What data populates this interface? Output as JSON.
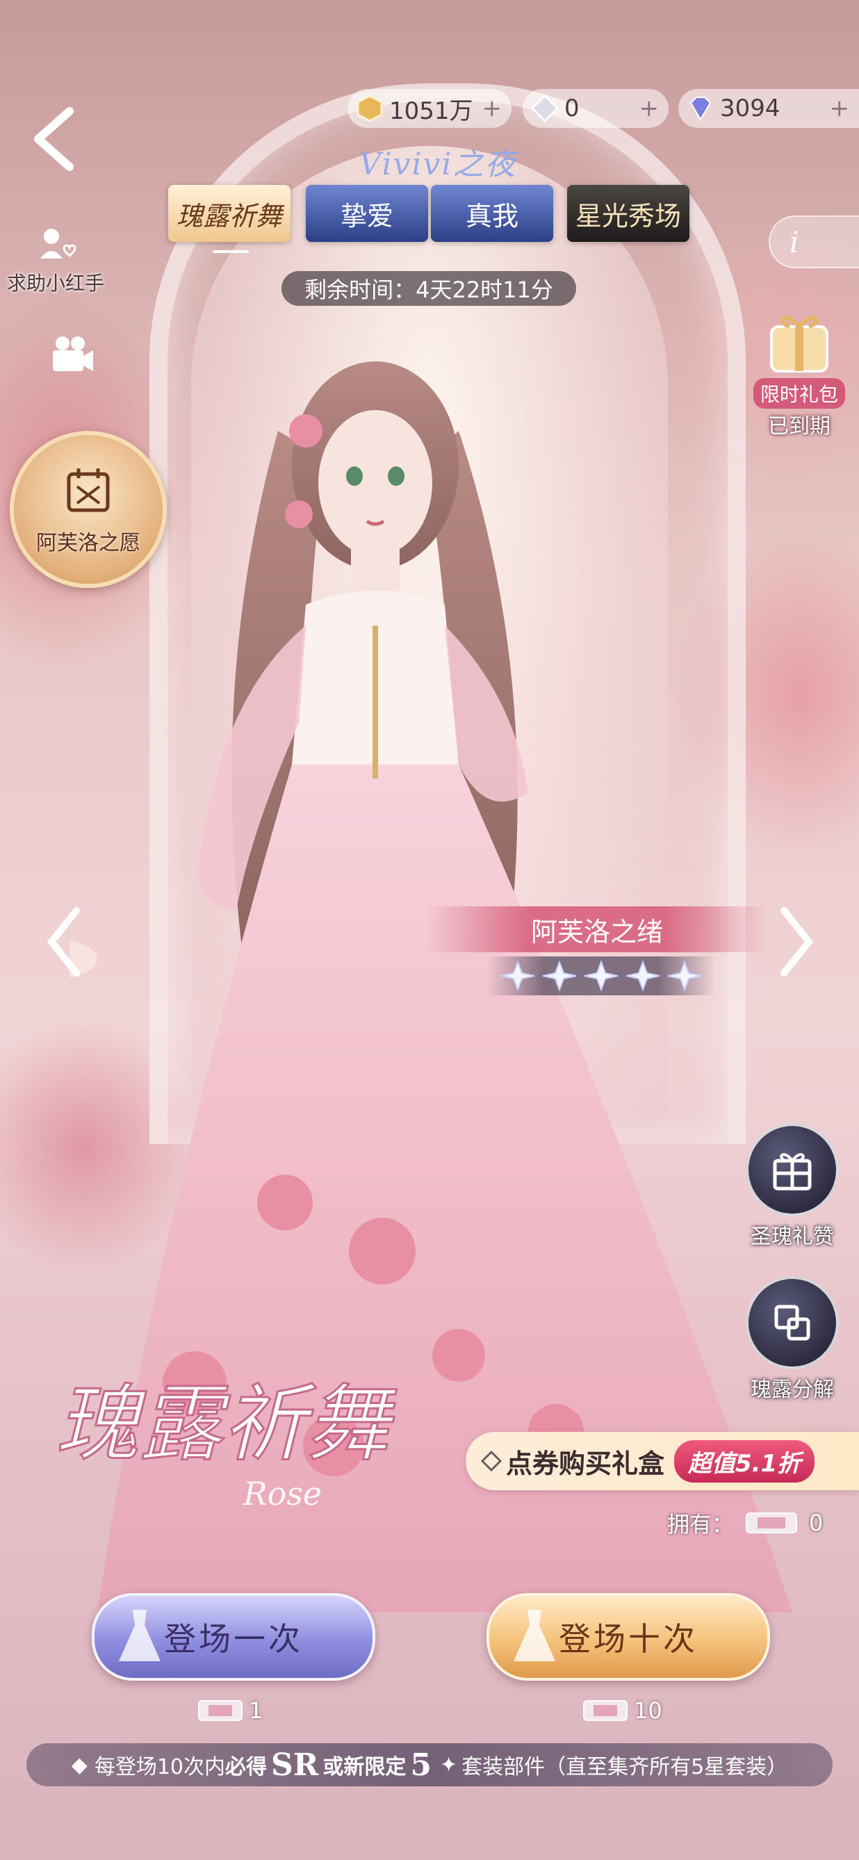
{
  "currency": {
    "gold": "1051万",
    "crystal": "0",
    "diamond": "3094"
  },
  "banner_title": "Vivivi之夜",
  "tabs": [
    {
      "label": "瑰露祈舞"
    },
    {
      "label": "挚爱"
    },
    {
      "label": "真我"
    },
    {
      "label": "星光秀场"
    }
  ],
  "timer": "剩余时间：4天22时11分",
  "left_menu": {
    "help_label": "求助小红手",
    "wish_label": "阿芙洛之愿"
  },
  "right_menu": {
    "gift_label_1": "限时礼包",
    "gift_label_2": "已到期",
    "reward_label": "圣瑰礼赞",
    "decompose_label": "瑰露分解"
  },
  "outfit": {
    "name": "阿芙洛之绪",
    "stars": 5
  },
  "logo": {
    "text": "瑰露祈舞",
    "sub": "Rose"
  },
  "promo": {
    "text": "点券购买礼盒",
    "badge": "超值5.1折"
  },
  "owned": {
    "label": "拥有：",
    "count": "0"
  },
  "draw": {
    "one_label": "登场一次",
    "one_cost": "1",
    "ten_label": "登场十次",
    "ten_cost": "10"
  },
  "footer": {
    "part1": "每登场10次内",
    "part2": "必得",
    "part3": "SR",
    "part4": "或新限定",
    "part5": "5",
    "part6": "套装部件（直至集齐所有5星套装）"
  },
  "colors": {
    "accent_pink": "#d45a7a",
    "tab_blue": "#2b3e86",
    "tab_gold": "#f0c78e",
    "draw_purple": "#8f8ee0",
    "draw_gold": "#f5c27c"
  }
}
